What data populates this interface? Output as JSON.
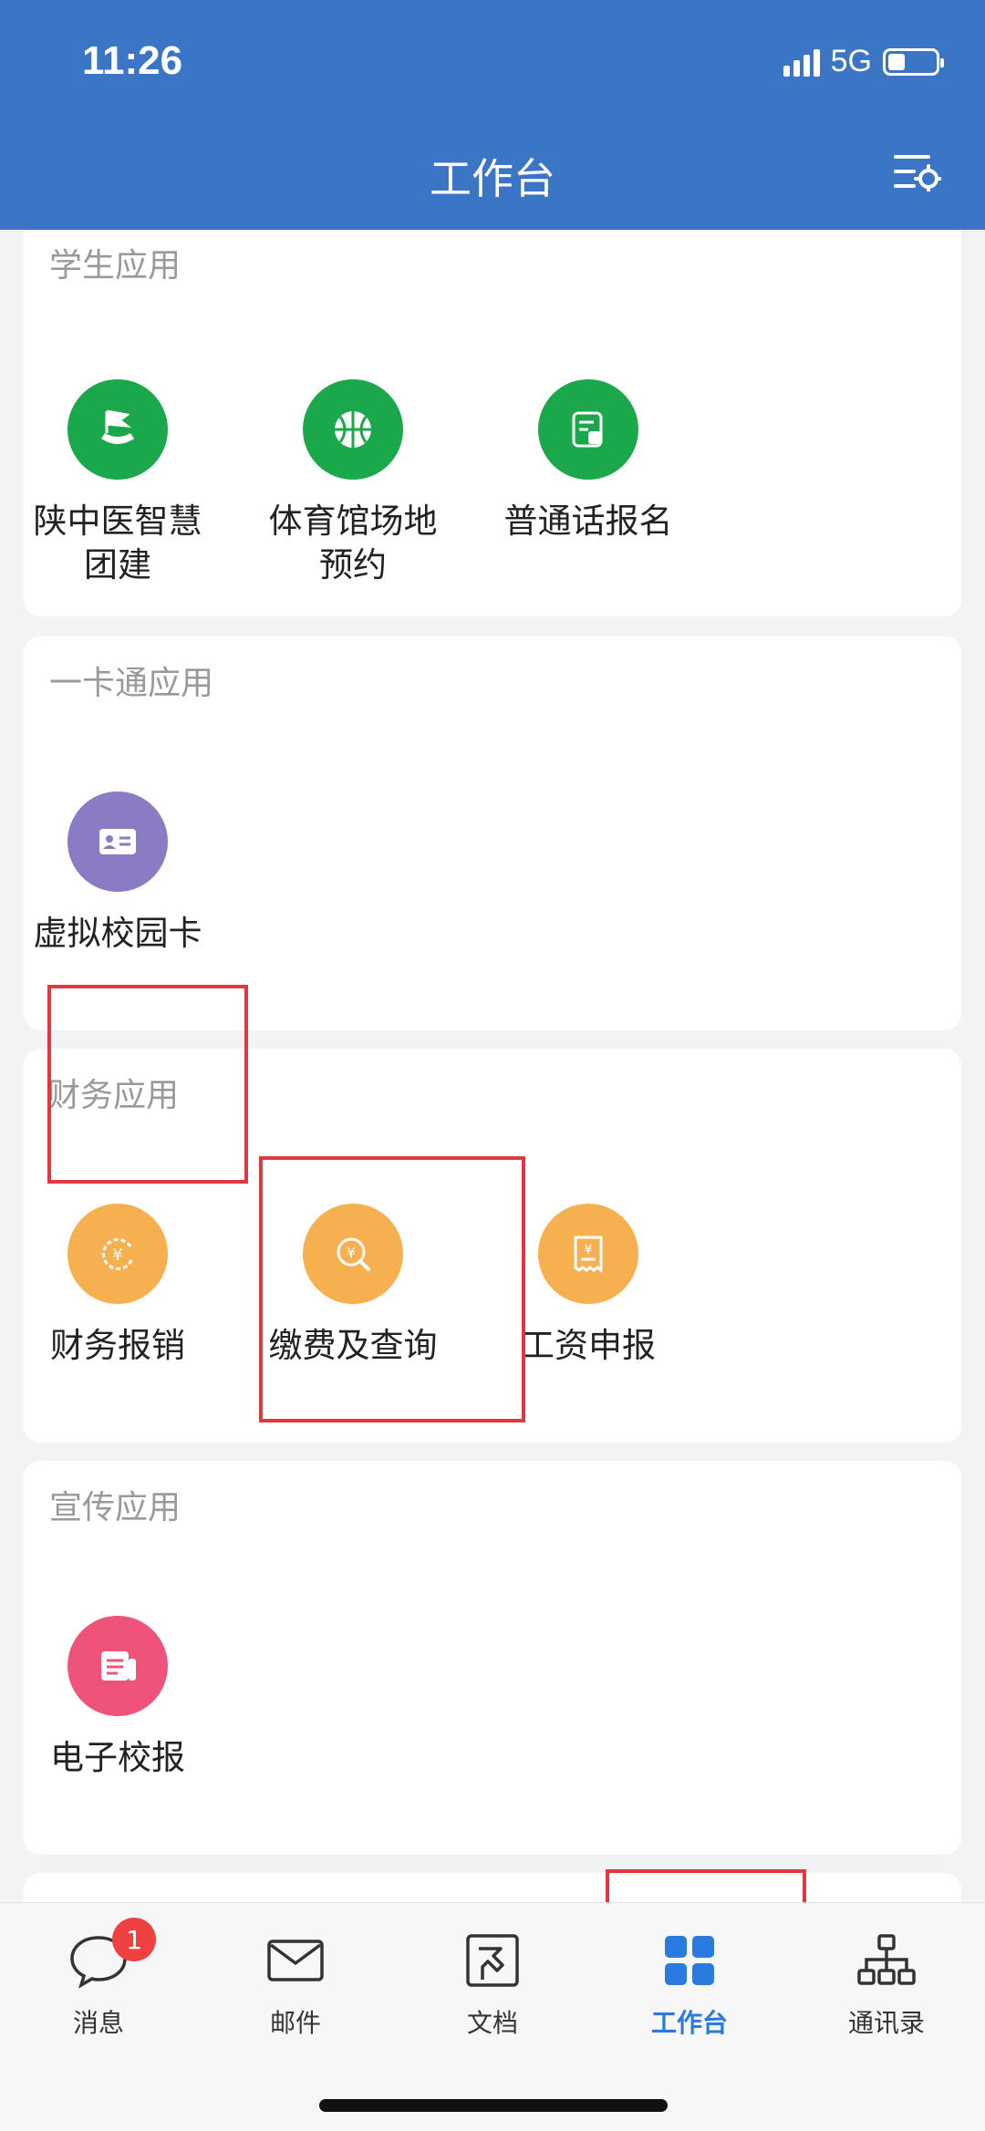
{
  "status_bar": {
    "time": "11:26",
    "network": "5G",
    "battery_fraction": 0.35
  },
  "header": {
    "title": "工作台",
    "settings_icon": "settings-sliders-icon"
  },
  "sections": [
    {
      "title": "学生应用",
      "apps": [
        {
          "label": "陕中医智慧团建",
          "icon": "flag-badge-icon",
          "color": "#1aa84a"
        },
        {
          "label": "体育馆场地预约",
          "icon": "basketball-icon",
          "color": "#1aa84a"
        },
        {
          "label": "普通话报名",
          "icon": "form-icon",
          "color": "#1aa84a"
        }
      ]
    },
    {
      "title": "一卡通应用",
      "apps": [
        {
          "label": "虚拟校园卡",
          "icon": "id-card-icon",
          "color": "#8b7ac4"
        }
      ]
    },
    {
      "title": "财务应用",
      "apps": [
        {
          "label": "财务报销",
          "icon": "yen-refresh-icon",
          "color": "#f6b050"
        },
        {
          "label": "缴费及查询",
          "icon": "yen-search-icon",
          "color": "#f6b050"
        },
        {
          "label": "工资申报",
          "icon": "yen-receipt-icon",
          "color": "#f6b050"
        }
      ]
    },
    {
      "title": "宣传应用",
      "apps": [
        {
          "label": "电子校报",
          "icon": "newspaper-icon",
          "color": "#f0537a"
        }
      ]
    }
  ],
  "tabbar": [
    {
      "label": "消息",
      "icon": "chat-bubble-icon",
      "badge": "1"
    },
    {
      "label": "邮件",
      "icon": "envelope-icon"
    },
    {
      "label": "文档",
      "icon": "document-icon"
    },
    {
      "label": "工作台",
      "icon": "grid-icon",
      "active": true
    },
    {
      "label": "通讯录",
      "icon": "org-chart-icon"
    }
  ],
  "colors": {
    "header_bg": "#3a75c6",
    "active_tab": "#2a7be0",
    "annotation": "#e0383e"
  }
}
